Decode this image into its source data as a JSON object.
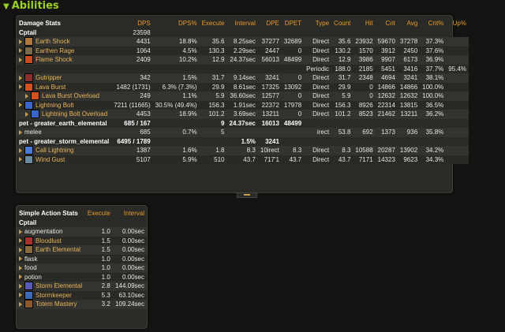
{
  "section": {
    "title": "Abilities"
  },
  "damage": {
    "headers": [
      "Damage Stats",
      "DPS",
      "DPS%",
      "Execute",
      "Interval",
      "DPE",
      "DPET",
      "Type",
      "Count",
      "Hit",
      "Crit",
      "Avg",
      "Crit%",
      "Up%"
    ],
    "player": {
      "name": "Cptail",
      "dps": "23598"
    },
    "rows": [
      {
        "kind": "ability",
        "name": "Earth Shock",
        "icon": "earth-shock-icon",
        "color": "#b07a3a",
        "cells": [
          "4431",
          "18.8%",
          "35.6",
          "8.25sec",
          "37277",
          "32689",
          "Direct",
          "35.6",
          "23932",
          "59670",
          "37278",
          "37.3%",
          ""
        ]
      },
      {
        "kind": "ability",
        "name": "Earthen Rage",
        "icon": "earthen-rage-icon",
        "color": "#7a6a4a",
        "cells": [
          "1064",
          "4.5%",
          "130.3",
          "2.29sec",
          "2447",
          "0",
          "Direct",
          "130.2",
          "1570",
          "3912",
          "2450",
          "37.6%",
          ""
        ]
      },
      {
        "kind": "ability",
        "name": "Flame Shock",
        "icon": "flame-shock-icon",
        "color": "#c84a1e",
        "cells": [
          "2409",
          "10.2%",
          "12.9",
          "24.37sec",
          "56013",
          "48499",
          "Direct",
          "12.9",
          "3986",
          "9907",
          "6173",
          "36.9%",
          ""
        ]
      },
      {
        "kind": "periodic",
        "cells": [
          "",
          "",
          "",
          "",
          "",
          "",
          "Periodic",
          "188.0",
          "2185",
          "5451",
          "3416",
          "37.7%",
          "95.4%"
        ]
      },
      {
        "kind": "ability",
        "name": "Gutripper",
        "icon": "gutripper-icon",
        "color": "#8a2e2e",
        "cells": [
          "342",
          "1.5%",
          "31.7",
          "9.14sec",
          "3241",
          "0",
          "Direct",
          "31.7",
          "2348",
          "4694",
          "3241",
          "38.1%",
          ""
        ]
      },
      {
        "kind": "ability",
        "name": "Lava Burst",
        "icon": "lava-burst-icon",
        "color": "#d2521e",
        "cells": [
          "1482 (1731)",
          "6.3% (7.3%)",
          "29.9",
          "8.61sec",
          "17325",
          "13092",
          "Direct",
          "29.9",
          "0",
          "14866",
          "14866",
          "100.0%",
          ""
        ]
      },
      {
        "kind": "sub",
        "name": "Lava Burst Overload",
        "icon": "lava-burst-overload-icon",
        "color": "#d2521e",
        "cells": [
          "249",
          "1.1%",
          "5.9",
          "36.60sec",
          "12577",
          "0",
          "Direct",
          "5.9",
          "0",
          "12632",
          "12632",
          "100.0%",
          ""
        ]
      },
      {
        "kind": "ability",
        "name": "Lightning Bolt",
        "icon": "lightning-bolt-icon",
        "color": "#3a66c8",
        "cells": [
          "7211 (11665)",
          "30.5% (49.4%)",
          "156.3",
          "1.91sec",
          "22372",
          "17978",
          "Direct",
          "156.3",
          "8926",
          "22314",
          "13815",
          "36.5%",
          ""
        ]
      },
      {
        "kind": "sub",
        "name": "Lightning Bolt Overload",
        "icon": "lightning-bolt-overload-icon",
        "color": "#3a66c8",
        "cells": [
          "4453",
          "18.9%",
          "101.2",
          "3.69sec",
          "13211",
          "0",
          "Direct",
          "101.2",
          "8523",
          "21462",
          "13211",
          "36.2%",
          ""
        ]
      },
      {
        "kind": "pet",
        "name": "pet - greater_earth_elemental",
        "cells": [
          "685 / 167",
          "",
          "9",
          "24.37sec",
          "16013",
          "48499",
          "",
          "",
          "",
          "",
          "",
          "",
          ""
        ]
      },
      {
        "kind": "plain",
        "name": "melee",
        "cells": [
          "685",
          "0.7%",
          "5",
          "",
          "",
          "",
          "irect",
          "53.8",
          "692",
          "1373",
          "936",
          "35.8%",
          ""
        ]
      },
      {
        "kind": "pet",
        "name": "pet - greater_storm_elemental",
        "cells": [
          "6495 / 1789",
          "",
          "",
          "1.5%",
          "3241",
          "",
          "",
          "",
          "",
          "",
          "",
          "",
          ""
        ]
      },
      {
        "kind": "ability",
        "name": "Call Lightning",
        "icon": "call-lightning-icon",
        "color": "#4a7ad8",
        "cells": [
          "1387",
          "1.6%",
          "1.8",
          "8.3",
          "10irect",
          "8.3",
          "Direct",
          "8.3",
          "10588",
          "20287",
          "13902",
          "34.2%",
          ""
        ]
      },
      {
        "kind": "ability",
        "name": "Wind Gust",
        "icon": "wind-gust-icon",
        "color": "#6a8aa0",
        "cells": [
          "5107",
          "5.9%",
          "510",
          "43.7",
          "717'1",
          "43.7",
          "Direct",
          "43.7",
          "7171",
          "14323",
          "9623",
          "34.3%",
          ""
        ]
      }
    ]
  },
  "actions": {
    "headers": [
      "Simple Action Stats",
      "Execute",
      "Interval"
    ],
    "player": {
      "name": "Cptail"
    },
    "rows": [
      {
        "name": "augmentation",
        "icon": "",
        "color": "",
        "execute": "1.0",
        "interval": "0.00sec"
      },
      {
        "name": "Bloodlust",
        "icon": "bloodlust-icon",
        "color": "#a8302a",
        "execute": "1.5",
        "interval": "0.00sec"
      },
      {
        "name": "Earth Elemental",
        "icon": "earth-elemental-icon",
        "color": "#8a6a3a",
        "execute": "1.5",
        "interval": "0.00sec"
      },
      {
        "name": "flask",
        "icon": "",
        "color": "",
        "execute": "1.0",
        "interval": "0.00sec"
      },
      {
        "name": "food",
        "icon": "",
        "color": "",
        "execute": "1.0",
        "interval": "0.00sec"
      },
      {
        "name": "potion",
        "icon": "",
        "color": "",
        "execute": "1.0",
        "interval": "0.00sec"
      },
      {
        "name": "Storm Elemental",
        "icon": "storm-elemental-icon",
        "color": "#5a5ab8",
        "execute": "2.8",
        "interval": "144.09sec"
      },
      {
        "name": "Stormkeeper",
        "icon": "stormkeeper-icon",
        "color": "#3a6ab8",
        "execute": "5.3",
        "interval": "63.10sec"
      },
      {
        "name": "Totem Mastery",
        "icon": "totem-mastery-icon",
        "color": "#8a5a2a",
        "execute": "3.2",
        "interval": "109.24sec"
      }
    ]
  }
}
